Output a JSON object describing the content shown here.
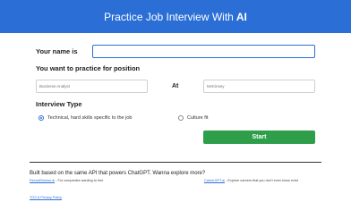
{
  "header": {
    "title": "Practice Job Interview With",
    "title_ai": "AI",
    "bg_color": "#2b6fd6"
  },
  "form": {
    "name_label": "Your name is",
    "name_value": "",
    "position_label": "You want to practice for position",
    "role_placeholder": "Business Analyst",
    "at_label": "At",
    "company_placeholder": "McKinsey",
    "interview_type_label": "Interview Type",
    "options": [
      {
        "label": "Technical, hard skills specific to the job",
        "selected": true
      },
      {
        "label": "Culture fit",
        "selected": false
      }
    ],
    "start_label": "Start",
    "start_color": "#2e9e4a"
  },
  "footer": {
    "text": "Built based on the same API that powers ChatGPT. Wanna explore more?",
    "link1": "RecruitGenius.ai",
    "link1_desc": "- For companies wanting to hire",
    "link2": "CareerGPT.ai",
    "link2_desc": "- Explore careers that you don't even know exist",
    "tos": "TOS & Privacy Policy"
  }
}
